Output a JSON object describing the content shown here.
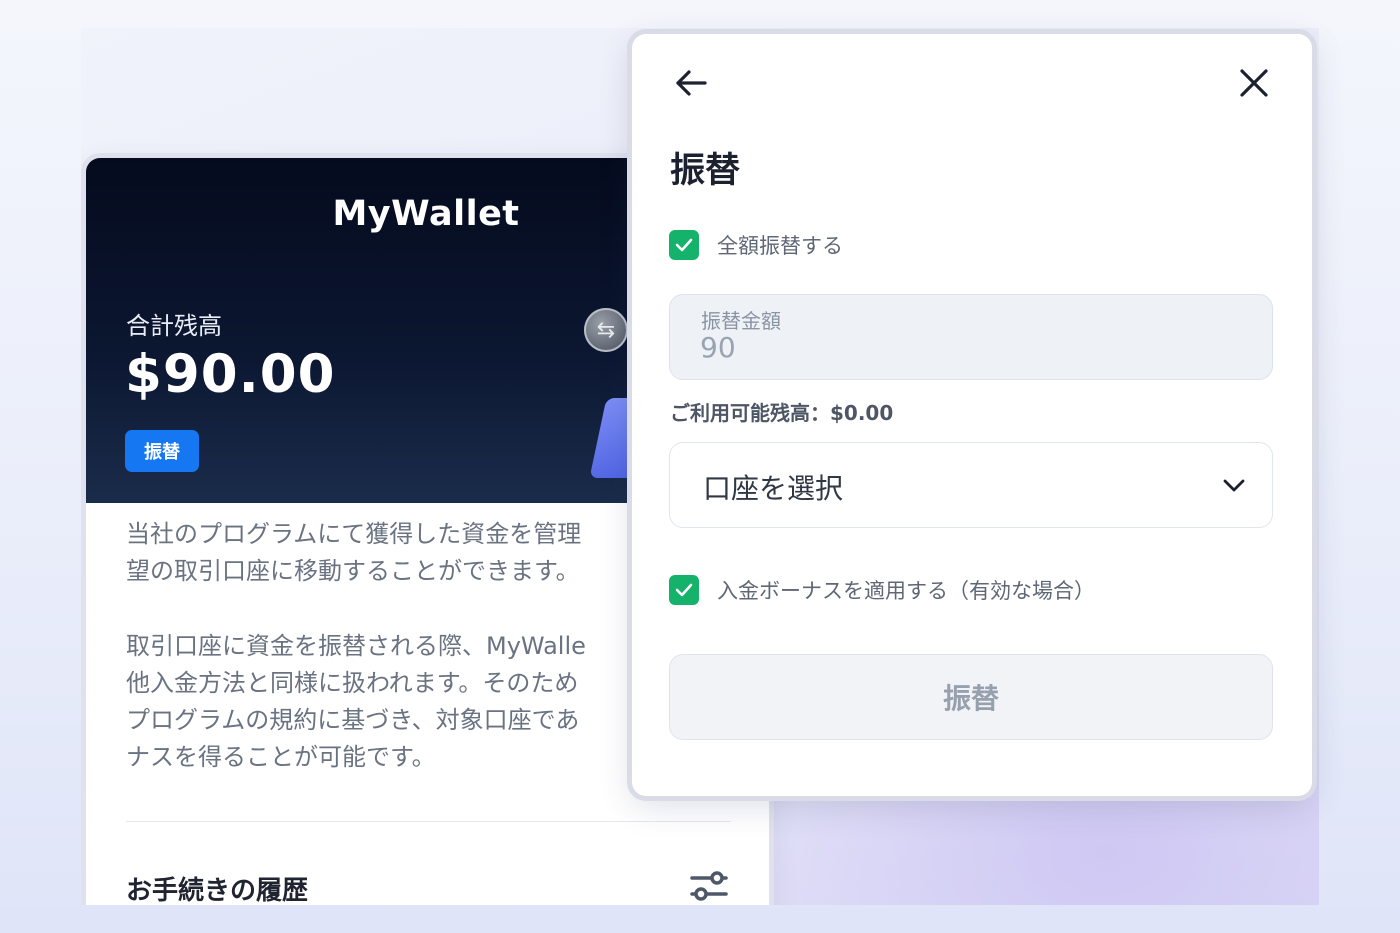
{
  "wallet": {
    "title": "MyWallet",
    "balance_label": "合計残高",
    "balance_amount": "$90.00",
    "transfer_button": "振替",
    "description_1": [
      "当社のプログラムにて獲得した資金を管理",
      "望の取引口座に移動することができます。"
    ],
    "description_2": [
      "取引口座に資金を振替される際、MyWalle",
      "他入金方法と同様に扱われます。そのため",
      "プログラムの規約に基づき、対象口座であ",
      "ナスを得ることが可能です。"
    ],
    "history_title": "お手続きの履歴",
    "icons": [
      "coin-transfer-icon",
      "filter-icon"
    ]
  },
  "modal": {
    "title": "振替",
    "full_amount_checkbox": {
      "label": "全額振替する",
      "checked": true
    },
    "amount_field": {
      "label": "振替金額",
      "value": "90"
    },
    "available_balance": "ご利用可能残高：$0.00",
    "account_select": {
      "value": "口座を選択"
    },
    "bonus_checkbox": {
      "label": "入金ボーナスを適用する（有効な場合）",
      "checked": true
    },
    "submit_button": "振替",
    "icons": [
      "back-arrow-icon",
      "close-icon",
      "checkmark-icon",
      "chevron-down-icon"
    ]
  },
  "colors": {
    "accent_blue": "#1677f2",
    "check_green": "#15b26b",
    "hero_dark": "#050b1e"
  }
}
